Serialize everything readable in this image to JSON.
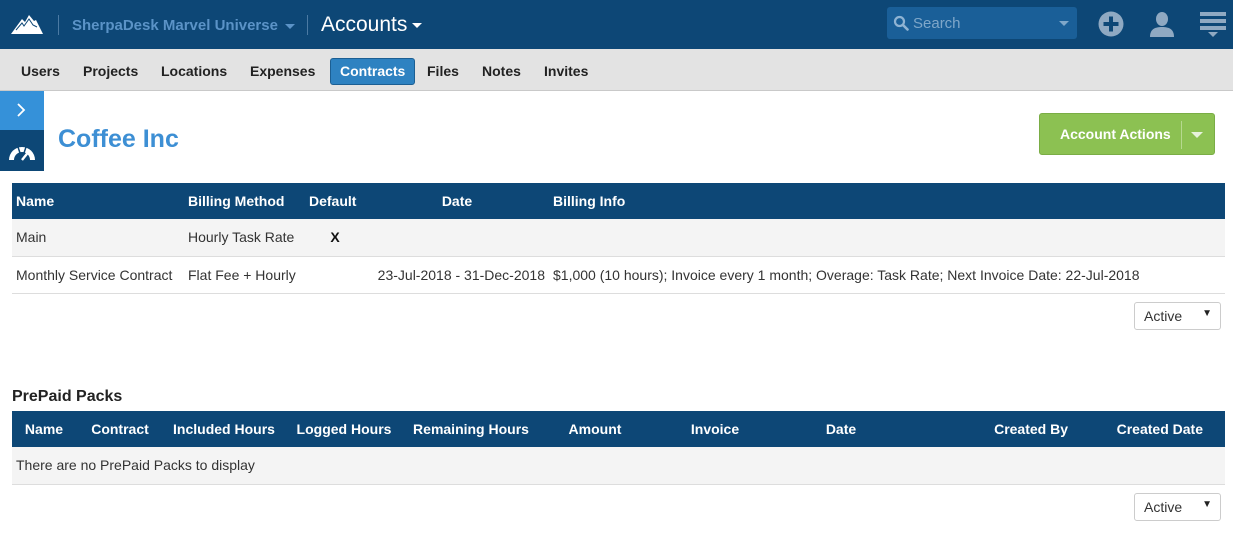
{
  "header": {
    "organization": "SherpaDesk Marvel Universe",
    "section": "Accounts",
    "search": {
      "placeholder": "Search",
      "value": ""
    },
    "icons": [
      "mountain-logo-icon",
      "search-icon",
      "plus-circle-icon",
      "user-icon",
      "menu-icon"
    ]
  },
  "tabs": [
    {
      "label": "Users",
      "active": false
    },
    {
      "label": "Projects",
      "active": false
    },
    {
      "label": "Locations",
      "active": false
    },
    {
      "label": "Expenses",
      "active": false
    },
    {
      "label": "Contracts",
      "active": true
    },
    {
      "label": "Files",
      "active": false
    },
    {
      "label": "Notes",
      "active": false
    },
    {
      "label": "Invites",
      "active": false
    }
  ],
  "page": {
    "title": "Coffee Inc",
    "actions_label": "Account Actions"
  },
  "contracts": {
    "columns": [
      "Name",
      "Billing Method",
      "Default",
      "Date",
      "Billing Info"
    ],
    "rows": [
      {
        "name": "Main",
        "billing_method": "Hourly Task Rate",
        "default": "X",
        "date": "",
        "billing_info": ""
      },
      {
        "name": "Monthly Service Contract",
        "billing_method": "Flat Fee + Hourly",
        "default": "",
        "date": "23-Jul-2018 - 31-Dec-2018",
        "billing_info": "$1,000 (10 hours); Invoice every 1 month; Overage: Task Rate; Next Invoice Date: 22-Jul-2018"
      }
    ],
    "status_filter": "Active"
  },
  "prepaid": {
    "title": "PrePaid Packs",
    "columns": [
      "Name",
      "Contract",
      "Included Hours",
      "Logged Hours",
      "Remaining Hours",
      "Amount",
      "Invoice",
      "Date",
      "Created By",
      "Created Date"
    ],
    "empty_message": "There are no PrePaid Packs to display",
    "status_filter": "Active"
  },
  "colors": {
    "navbar": "#0d4776",
    "accent": "#3d8fd4",
    "active_tab": "#2e82c1",
    "action_button": "#8cc152"
  }
}
